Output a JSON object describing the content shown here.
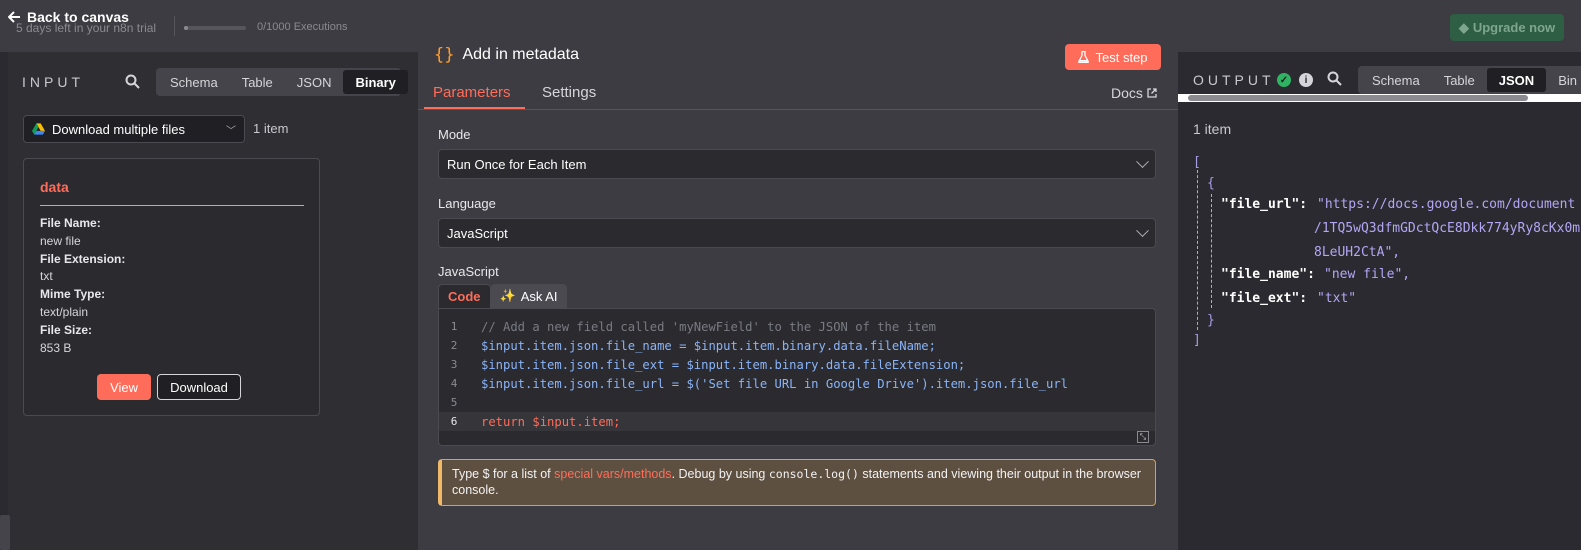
{
  "topbar": {
    "back_label": "Back to canvas",
    "trial_text": "5 days left in your n8n trial",
    "executions_text": "0/1000 Executions",
    "executions_used_fraction": 0.0,
    "upgrade_label": "Upgrade now"
  },
  "input": {
    "title": "INPUT",
    "view_tabs": [
      "Schema",
      "Table",
      "JSON",
      "Binary"
    ],
    "active_view": "Binary",
    "node_select": "Download multiple files",
    "item_count": "1 item",
    "binary_card": {
      "title": "data",
      "fields": [
        {
          "label": "File Name:",
          "value": "new file"
        },
        {
          "label": "File Extension:",
          "value": "txt"
        },
        {
          "label": "Mime Type:",
          "value": "text/plain"
        },
        {
          "label": "File Size:",
          "value": "853 B"
        }
      ],
      "view_label": "View",
      "download_label": "Download"
    }
  },
  "node": {
    "icon": "code-braces-icon",
    "title": "Add in metadata",
    "test_step_label": "Test step",
    "tabs": [
      "Parameters",
      "Settings"
    ],
    "active_tab": "Parameters",
    "docs_label": "Docs",
    "mode_label": "Mode",
    "mode_value": "Run Once for Each Item",
    "language_label": "Language",
    "language_value": "JavaScript",
    "code_label": "JavaScript",
    "code_tabs": [
      "Code",
      "Ask AI"
    ],
    "code_lines": [
      "// Add a new field called 'myNewField' to the JSON of the item",
      "$input.item.json.file_name = $input.item.binary.data.fileName;",
      "$input.item.json.file_ext = $input.item.binary.data.fileExtension;",
      "$input.item.json.file_url = $('Set file URL in Google Drive').item.json.file_url",
      "",
      "return $input.item;"
    ],
    "hint": {
      "before": "Type $ for a list of ",
      "link": "special vars/methods",
      "middle": ". Debug by using ",
      "code": "console.log()",
      "after": " statements and viewing their output in the browser console."
    }
  },
  "output": {
    "title": "OUTPUT",
    "view_tabs": [
      "Schema",
      "Table",
      "JSON",
      "Bin"
    ],
    "active_view": "JSON",
    "item_count": "1 item",
    "json": {
      "open_bracket": "[",
      "open_brace": "{",
      "file_url_key": "\"file_url\":",
      "file_url_parts": [
        "\"https://docs.google.com/document",
        "/1TQ5wQ3dfmGDctQcE8Dkk774yRy8cKx0m",
        "8LeUH2CtA\","
      ],
      "file_name_key": "\"file_name\":",
      "file_name_value": "\"new file\",",
      "file_ext_key": "\"file_ext\":",
      "file_ext_value": "\"txt\"",
      "close_brace": "}",
      "close_bracket": "]"
    }
  },
  "colors": {
    "accent": "#ff6d5a",
    "success": "#2fb363",
    "json_value": "#b4a7f5",
    "background": "#2a2a30"
  }
}
